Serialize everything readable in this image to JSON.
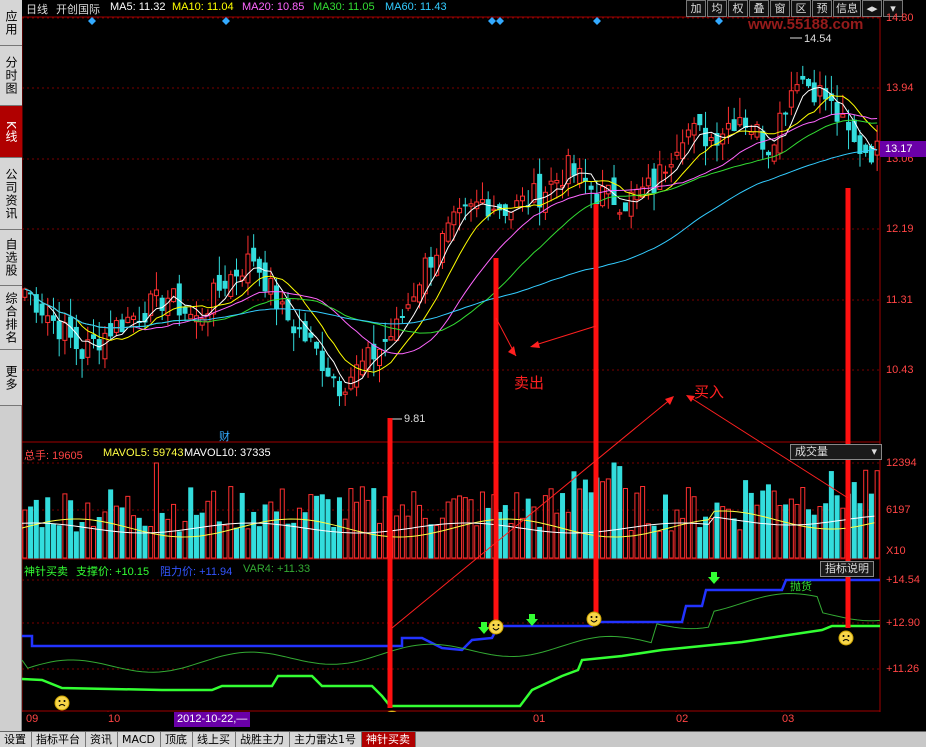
{
  "sidebar": {
    "tabs": [
      {
        "label": "应用",
        "active": false
      },
      {
        "label": "分时图",
        "active": false
      },
      {
        "label": "K线",
        "active": true
      },
      {
        "label": "公司资讯",
        "active": false
      },
      {
        "label": "自选股",
        "active": false
      },
      {
        "label": "综合排名",
        "active": false
      },
      {
        "label": "更多",
        "active": false
      }
    ]
  },
  "header": {
    "period": "日线",
    "stock_name": "开创国际",
    "ma": [
      {
        "label": "MA5: 11.32",
        "color": "#ffffff"
      },
      {
        "label": "MA10: 11.04",
        "color": "#ffff00"
      },
      {
        "label": "MA20: 10.85",
        "color": "#ff66ff"
      },
      {
        "label": "MA30: 11.05",
        "color": "#33dd33"
      },
      {
        "label": "MA60: 11.43",
        "color": "#33ccff"
      }
    ],
    "tools": [
      "加",
      "均",
      "权",
      "叠",
      "窗",
      "区",
      "预",
      "信息",
      "◂▸",
      "▾"
    ],
    "watermark": "www.55188.com"
  },
  "price_axis": {
    "labels": [
      "14.80",
      "13.94",
      "13.06",
      "12.19",
      "11.31",
      "10.43"
    ],
    "current_price": "13.17",
    "high_marker": "14.54",
    "low_marker": "9.81",
    "finance_marker": "财"
  },
  "annotations": {
    "sell": "卖出",
    "buy": "买入"
  },
  "volume": {
    "total_label": "总手: 19605",
    "mavol5": "MAVOL5: 59743",
    "mavol10": "MAVOL10: 37335",
    "dropdown": "成交量",
    "axis_labels": [
      "12394",
      "6197"
    ],
    "unit": "X10"
  },
  "indicator": {
    "name": "神针买卖",
    "support": "支撑价: +10.15",
    "resistance": "阻力价: +11.94",
    "var4": "VAR4: +11.33",
    "help_button": "指标说明",
    "axis_labels": [
      "+14.54",
      "+12.90",
      "+11.26"
    ],
    "annotation": "抛货",
    "colors": {
      "support": "#33ff33",
      "resistance": "#2233ff",
      "var4": "#33aa33"
    }
  },
  "time_axis": {
    "labels": [
      "09",
      "10",
      "01",
      "02",
      "03"
    ],
    "cursor_date": "2012-10-22,—"
  },
  "bottom_tabs": [
    {
      "label": "设置",
      "active": false
    },
    {
      "label": "指标平台",
      "active": false
    },
    {
      "label": "资讯",
      "active": false
    },
    {
      "label": "MACD",
      "active": false
    },
    {
      "label": "顶底",
      "active": false
    },
    {
      "label": "线上买",
      "active": false
    },
    {
      "label": "战胜主力",
      "active": false
    },
    {
      "label": "主力雷达1号",
      "active": false
    },
    {
      "label": "神针买卖",
      "active": true
    }
  ],
  "chart_data": {
    "type": "candlestick",
    "price_range": [
      9.6,
      14.9
    ],
    "days": 150,
    "candles_seed": "approximate visual reconstruction",
    "volume_range": [
      0,
      13000
    ]
  }
}
